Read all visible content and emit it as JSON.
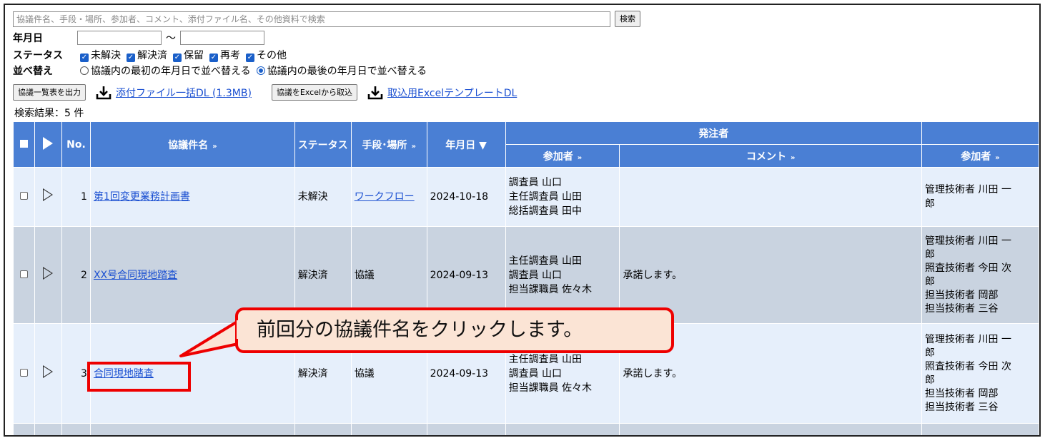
{
  "search": {
    "placeholder": "協議件名、手段・場所、参加者、コメント、添付ファイル名、その他資料で検索",
    "button_label": "検索"
  },
  "filters": {
    "date_label": "年月日",
    "date_separator": "～",
    "status_label": "ステータス",
    "status_options": [
      "未解決",
      "解決済",
      "保留",
      "再考",
      "その他"
    ],
    "sort_label": "並べ替え",
    "sort_options": [
      "協議内の最初の年月日で並べ替える",
      "協議内の最後の年月日で並べ替える"
    ],
    "sort_selected_index": 1
  },
  "actions": {
    "export_button": "協議一覧表を出力",
    "attach_dl_link": "添付ファイル一括DL (1.3MB)",
    "import_button": "協議をExcelから取込",
    "template_dl_link": "取込用ExcelテンプレートDL"
  },
  "result_count": "検索結果：5 件",
  "table": {
    "headers": {
      "no": "No.",
      "title": "協議件名",
      "status": "ステータス",
      "method": "手段･場所",
      "date": "年月日 ▼",
      "orderer_group": "発注者",
      "participants": "参加者",
      "comment": "コメント",
      "participants_right": "参加者"
    },
    "rows": [
      {
        "no": "1",
        "title": "第1回変更業務計画書",
        "status": "未解決",
        "method": "ワークフロー",
        "date": "2024-10-18",
        "participants": [
          "調査員 山口",
          "主任調査員 山田",
          "総括調査員 田中"
        ],
        "comment": "",
        "participants_right": [
          "管理技術者 川田 一",
          "郎"
        ]
      },
      {
        "no": "2",
        "title": "XX号合同現地踏査",
        "status": "解決済",
        "method": "協議",
        "date": "2024-09-13",
        "participants": [
          "主任調査員 山田",
          "調査員 山口",
          "担当課職員 佐々木"
        ],
        "comment": "承諾します。",
        "participants_right": [
          "管理技術者 川田 一",
          "郎",
          "照査技術者 今田 次",
          "郎",
          "担当技術者 岡部",
          "担当技術者 三谷"
        ]
      },
      {
        "no": "3",
        "title": "合同現地踏査",
        "status": "解決済",
        "method": "協議",
        "date": "2024-09-13",
        "participants": [
          "主任調査員 山田",
          "調査員 山口",
          "担当課職員 佐々木"
        ],
        "comment": "承諾します。",
        "participants_right": [
          "管理技術者 川田 一",
          "郎",
          "照査技術者 今田 次",
          "郎",
          "担当技術者 岡部",
          "担当技術者 三谷"
        ]
      }
    ]
  },
  "callout": "前回分の協議件名をクリックします。",
  "colors": {
    "header_blue": "#4a7fd4",
    "row_light": "#e6effb",
    "row_dark": "#c9d3e0",
    "callout_red": "#ee0000",
    "callout_fill": "#fbe4d5"
  }
}
